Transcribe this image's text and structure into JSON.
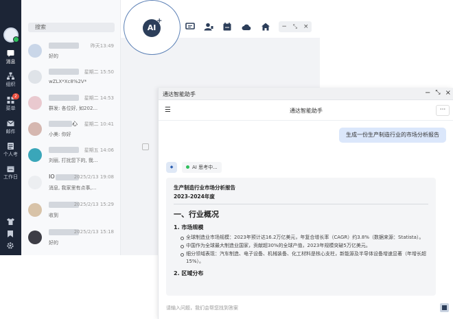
{
  "sidebar": {
    "nav": [
      {
        "label": "消息",
        "icon": "message-icon",
        "active": true
      },
      {
        "label": "组织",
        "icon": "org-icon"
      },
      {
        "label": "菜单",
        "icon": "apps-icon",
        "badge": "2"
      },
      {
        "label": "邮件",
        "icon": "mail-icon"
      },
      {
        "label": "个人考",
        "icon": "personal-icon"
      },
      {
        "label": "工作日",
        "icon": "calendar-icon"
      }
    ]
  },
  "chatlist": {
    "search_placeholder": "搜索",
    "items": [
      {
        "time": "昨天13:49",
        "message": "好的"
      },
      {
        "time": "星期二 15:50",
        "message": "wZLX*Xc8%2V*"
      },
      {
        "time": "星期二 14:53",
        "message": "群发: 各位好, 如202..."
      },
      {
        "name_suffix": "心",
        "time": "星期二 10:41",
        "message": "小美: 你好"
      },
      {
        "time": "星期五 14:06",
        "message": "刘丽, 打扰您下的, 我..."
      },
      {
        "name_prefix": "IO",
        "time": "2025/2/13 19:08",
        "message": "消息, 我家里有点事,..."
      },
      {
        "time": "2025/2/13 15:29",
        "message": "收到"
      },
      {
        "time": "2025/2/13 15:18",
        "message": "好的"
      }
    ]
  },
  "toolbar": {
    "ai_label": "AI",
    "icons": [
      "chat-icon",
      "contact-icon",
      "calendar-icon",
      "cloud-icon",
      "home-icon"
    ]
  },
  "assistant": {
    "window_title": "通达智能助手",
    "header_title": "通达智能助手",
    "user_message": "生成一份生产制造行业的市场分析报告",
    "status": "AI 思考中...",
    "report": {
      "title": "生产制造行业市场分析报告",
      "subtitle": "2023-2024年度",
      "section1": "一、行业概况",
      "sub1": "1. 市场规模",
      "bullets": [
        "全球制造业市场规模：2023年预计达16.2万亿美元，年复合增长率（CAGR）约3.8%（数据来源：Statista）。",
        "中国作为全球最大制造业国家，贡献超30%的全球产值，2023年规模突破5万亿美元。",
        "细分领域表现：汽车制造、电子设备、机械装备、化工材料是核心支柱，新能源及半导体设备增速显著（年增长超15%）。"
      ],
      "sub2": "2. 区域分布"
    },
    "input_placeholder": "请输入问题，我们会帮您找到答案"
  }
}
